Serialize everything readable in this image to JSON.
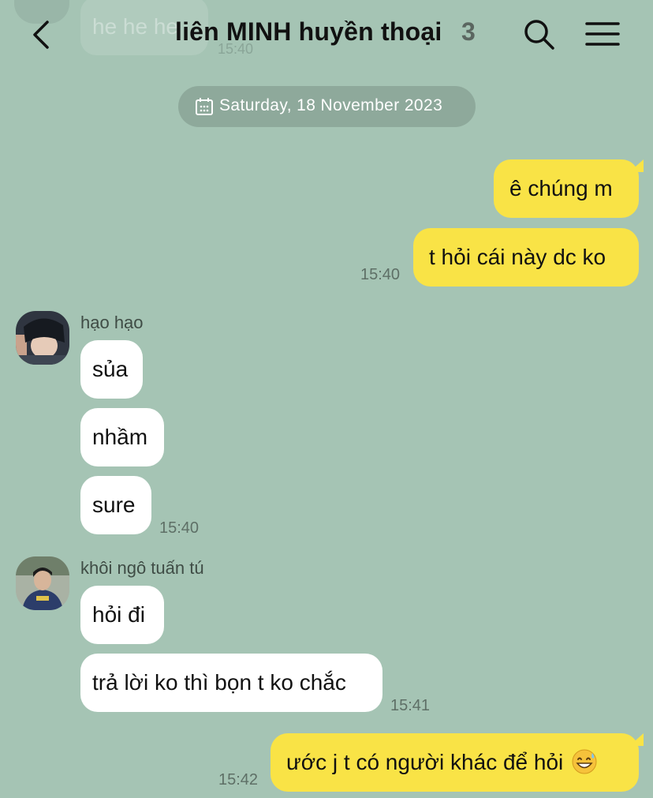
{
  "header": {
    "title": "liên MINH huyền thoại",
    "member_count": "3",
    "back_icon": "chevron-left-icon",
    "search_icon": "search-icon",
    "menu_icon": "menu-icon"
  },
  "previous_message": {
    "text": "he he he",
    "time": "15:40"
  },
  "date_divider": "Saturday, 18 November 2023",
  "messages": {
    "m1": "ê chúng m",
    "m2": "t hỏi cái này dc ko",
    "m2_time": "15:40",
    "sender1": "hạo hạo",
    "m3": "sủa",
    "m4": "nhầm",
    "m5": "sure",
    "m5_time": "15:40",
    "sender2": "khôi ngô tuấn tú",
    "m6": "hỏi đi",
    "m7": "trả lời ko thì bọn t ko chắc",
    "m7_time": "15:41",
    "m8": "ước j t có người khác để hỏi",
    "m8_emoji": "grinning-face-with-sweat-icon",
    "m8_time": "15:42"
  },
  "colors": {
    "background": "#a5c4b4",
    "outgoing_bubble": "#f9e346",
    "incoming_bubble": "#ffffff",
    "date_pill": "#8ea99b"
  }
}
